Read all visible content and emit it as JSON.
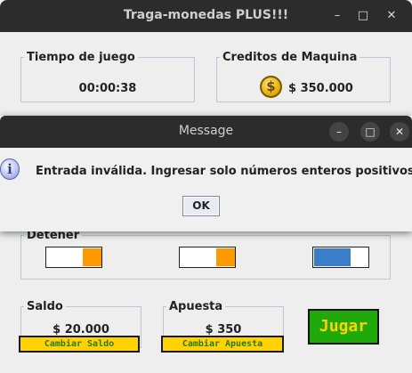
{
  "window": {
    "title": "Traga-monedas PLUS!!!",
    "minimize": "–",
    "maximize": "□",
    "close": "✕"
  },
  "time_panel": {
    "label": "Tiempo de juego",
    "value": "00:00:38"
  },
  "credits_panel": {
    "label": "Creditos de Maquina",
    "coin_icon": "coin-icon",
    "coin_symbol": "$",
    "value": "$ 350.000"
  },
  "detener": {
    "label": "Detener",
    "slots": [
      {
        "color": "#ff9900",
        "fill": "orange"
      },
      {
        "color": "#ff9900",
        "fill": "orange"
      },
      {
        "color": "#3a7dc9",
        "fill": "blue"
      }
    ]
  },
  "saldo": {
    "label": "Saldo",
    "value": "$ 20.000",
    "button": "Cambiar Saldo"
  },
  "apuesta": {
    "label": "Apuesta",
    "value": "$ 350",
    "button": "Cambiar Apuesta"
  },
  "play_button": "Jugar",
  "colors": {
    "accent_yellow": "#ffd200",
    "play_green": "#1faa0a",
    "button_text_green": "#2a7a10"
  },
  "dialog": {
    "title": "Message",
    "icon": "info-icon",
    "icon_glyph": "i",
    "message": "Entrada inválida. Ingresar solo números enteros positivos.",
    "ok": "OK",
    "minimize": "–",
    "maximize": "□",
    "close": "✕"
  }
}
